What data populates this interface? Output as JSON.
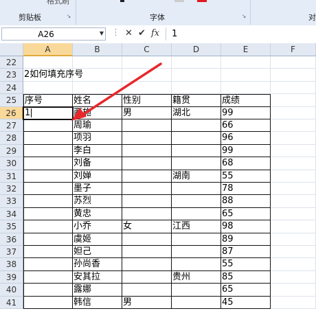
{
  "ribbon": {
    "clipboard_label": "剪贴板",
    "format_painter_label": "格式刷",
    "font_label": "字体",
    "cut_group_label": "对"
  },
  "formula_bar": {
    "name_box": "A26",
    "value": "1"
  },
  "columns": [
    "A",
    "B",
    "C",
    "D",
    "E",
    "F"
  ],
  "rows": [
    {
      "num": "22",
      "cells": [
        "",
        "",
        "",
        "",
        "",
        ""
      ]
    },
    {
      "num": "23",
      "cells": [
        "2如何填充序号",
        "",
        "",
        "",
        "",
        ""
      ]
    },
    {
      "num": "24",
      "cells": [
        "",
        "",
        "",
        "",
        "",
        ""
      ]
    },
    {
      "num": "25",
      "cells": [
        "序号",
        "姓名",
        "性别",
        "籍贯",
        "成绩",
        ""
      ]
    },
    {
      "num": "26",
      "cells": [
        "1",
        "西施",
        "男",
        "湖北",
        "99",
        ""
      ]
    },
    {
      "num": "27",
      "cells": [
        "",
        "周瑜",
        "",
        "",
        "66",
        ""
      ]
    },
    {
      "num": "28",
      "cells": [
        "",
        "项羽",
        "",
        "",
        "96",
        ""
      ]
    },
    {
      "num": "29",
      "cells": [
        "",
        "李白",
        "",
        "",
        "99",
        ""
      ]
    },
    {
      "num": "30",
      "cells": [
        "",
        "刘备",
        "",
        "",
        "68",
        ""
      ]
    },
    {
      "num": "31",
      "cells": [
        "",
        "刘婵",
        "",
        "湖南",
        "55",
        ""
      ]
    },
    {
      "num": "32",
      "cells": [
        "",
        "墨子",
        "",
        "",
        "78",
        ""
      ]
    },
    {
      "num": "33",
      "cells": [
        "",
        "苏烈",
        "",
        "",
        "88",
        ""
      ]
    },
    {
      "num": "34",
      "cells": [
        "",
        "黄忠",
        "",
        "",
        "65",
        ""
      ]
    },
    {
      "num": "35",
      "cells": [
        "",
        "小乔",
        "女",
        "江西",
        "98",
        ""
      ]
    },
    {
      "num": "36",
      "cells": [
        "",
        "虞姬",
        "",
        "",
        "89",
        ""
      ]
    },
    {
      "num": "37",
      "cells": [
        "",
        "妲己",
        "",
        "",
        "87",
        ""
      ]
    },
    {
      "num": "38",
      "cells": [
        "",
        "孙尚香",
        "",
        "",
        "55",
        ""
      ]
    },
    {
      "num": "39",
      "cells": [
        "",
        "安其拉",
        "",
        "贵州",
        "85",
        ""
      ]
    },
    {
      "num": "40",
      "cells": [
        "",
        "露娜",
        "",
        "",
        "65",
        ""
      ]
    },
    {
      "num": "41",
      "cells": [
        "",
        "韩信",
        "男",
        "",
        "45",
        ""
      ]
    }
  ],
  "colors": {
    "arrow": "#e8272a",
    "selection_header": "#f9d99a"
  }
}
